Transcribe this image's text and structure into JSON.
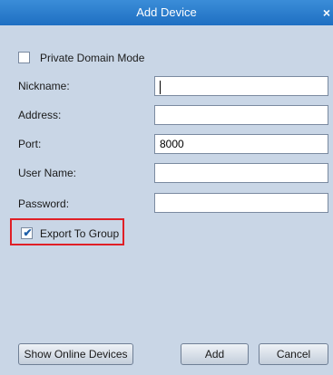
{
  "window": {
    "title": "Add Device",
    "close_glyph": "×"
  },
  "form": {
    "private_domain_label": "Private Domain Mode",
    "private_domain_checked": false,
    "nickname": {
      "label": "Nickname:",
      "value": ""
    },
    "address": {
      "label": "Address:",
      "value": ""
    },
    "port": {
      "label": "Port:",
      "value": "8000"
    },
    "username": {
      "label": "User Name:",
      "value": ""
    },
    "password": {
      "label": "Password:",
      "value": ""
    },
    "export_group_label": "Export To Group",
    "export_group_checked": true,
    "check_glyph": "✔"
  },
  "buttons": {
    "show_online": "Show Online Devices",
    "add": "Add",
    "cancel": "Cancel"
  },
  "colors": {
    "title_bar": "#2a7fd0",
    "panel": "#c9d6e6",
    "highlight": "#e01f26"
  }
}
